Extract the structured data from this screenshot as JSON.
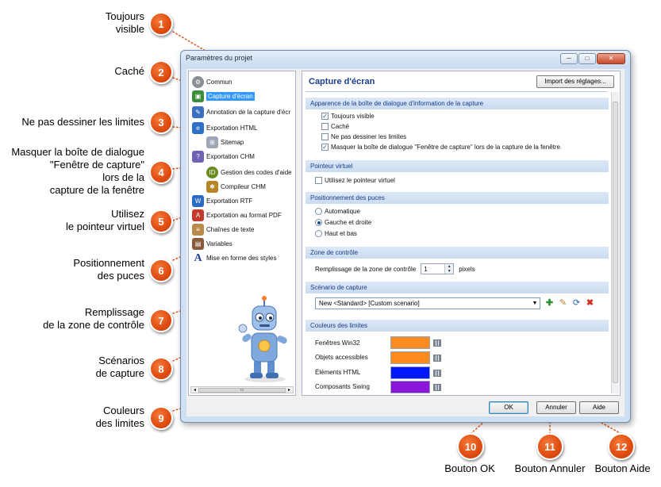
{
  "callouts": [
    {
      "n": "1",
      "label": "Toujours\nvisible"
    },
    {
      "n": "2",
      "label": "Caché"
    },
    {
      "n": "3",
      "label": "Ne pas dessiner les limites"
    },
    {
      "n": "4",
      "label": "Masquer la boîte de dialogue\n\"Fenêtre de capture\"\nlors de la\ncapture de la fenêtre"
    },
    {
      "n": "5",
      "label": "Utilisez\nle pointeur virtuel"
    },
    {
      "n": "6",
      "label": "Positionnement\ndes puces"
    },
    {
      "n": "7",
      "label": "Remplissage\nde la zone de contrôle"
    },
    {
      "n": "8",
      "label": "Scénarios\nde capture"
    },
    {
      "n": "9",
      "label": "Couleurs\ndes limites"
    },
    {
      "n": "10",
      "label": "Bouton OK"
    },
    {
      "n": "11",
      "label": "Bouton Annuler"
    },
    {
      "n": "12",
      "label": "Bouton Aide"
    }
  ],
  "window": {
    "title": "Paramètres du projet",
    "minimize": "─",
    "maximize": "□",
    "close": "✕"
  },
  "tree": {
    "items": [
      {
        "label": "Commun",
        "icon": "gear-icon",
        "color": "#8a8f96"
      },
      {
        "label": "Capture d'écran",
        "icon": "screen-capture-icon",
        "color": "#3c8e3c"
      },
      {
        "label": "Annotation de la capture d'écr",
        "icon": "annotation-icon",
        "color": "#3d6fc0"
      },
      {
        "label": "Exportation HTML",
        "icon": "html-export-icon",
        "color": "#2f6fc8"
      },
      {
        "label": "Sitemap",
        "icon": "sitemap-icon",
        "color": "#9ea7b3"
      },
      {
        "label": "Exportation CHM",
        "icon": "chm-export-icon",
        "color": "#6e62b7"
      },
      {
        "label": "Gestion des codes d'aide",
        "icon": "help-id-icon",
        "color": "#6a8b1f"
      },
      {
        "label": "Compileur CHM",
        "icon": "compiler-icon",
        "color": "#b78526"
      },
      {
        "label": "Exportation RTF",
        "icon": "rtf-export-icon",
        "color": "#2b6cc4"
      },
      {
        "label": "Exportation au format PDF",
        "icon": "pdf-export-icon",
        "color": "#c33b2d"
      },
      {
        "label": "Chaînes de texte",
        "icon": "text-strings-icon",
        "color": "#b98b4a"
      },
      {
        "label": "Variables",
        "icon": "variables-icon",
        "color": "#8a5a3c"
      },
      {
        "label": "Mise en forme des styles",
        "icon": "styles-icon",
        "color": "#1f3f9a"
      }
    ],
    "hscroll_label": "ııı"
  },
  "panel": {
    "title": "Capture d'écran",
    "import_button": "Import des réglages...",
    "sections": {
      "appearance": "Apparence de la boîte de dialogue d'information de la capture",
      "virtual_pointer": "Pointeur virtuel",
      "bullets": "Positionnement des puces",
      "control_zone": "Zone de contrôle",
      "scenario": "Scénario de capture",
      "colors": "Couleurs des limites"
    },
    "checkboxes": {
      "always_visible": {
        "label": "Toujours visible",
        "checked": true
      },
      "hidden": {
        "label": "Caché",
        "checked": false
      },
      "no_borders": {
        "label": "Ne pas dessiner les limites",
        "checked": false
      },
      "hide_dialog": {
        "label": "Masquer la boîte de dialogue \"Fenêtre de capture\" lors de la capture de la fenêtre",
        "checked": true
      },
      "use_pointer": {
        "label": "Utilisez le pointeur virtuel",
        "checked": false
      }
    },
    "radios": [
      {
        "label": "Automatique",
        "selected": false
      },
      {
        "label": "Gauche et droite",
        "selected": true
      },
      {
        "label": "Haut et bas",
        "selected": false
      }
    ],
    "padding": {
      "label": "Remplissage de la zone de contrôle",
      "value": "1",
      "unit": "pixels"
    },
    "scenario_value": "New <Standard> [Custom scenario]",
    "scenario_tools": [
      "add-icon",
      "edit-icon",
      "refresh-icon",
      "delete-icon"
    ],
    "border_colors": [
      {
        "label": "Fenêtres Win32",
        "color": "#ff8a1e"
      },
      {
        "label": "Objets accessibles",
        "color": "#ff8a1e"
      },
      {
        "label": "Éléments HTML",
        "color": "#0018ff"
      },
      {
        "label": "Composants Swing",
        "color": "#8a16d8"
      }
    ]
  },
  "buttons": {
    "ok": "OK",
    "cancel": "Annuler",
    "help": "Aide"
  },
  "accent": "#e04e12"
}
